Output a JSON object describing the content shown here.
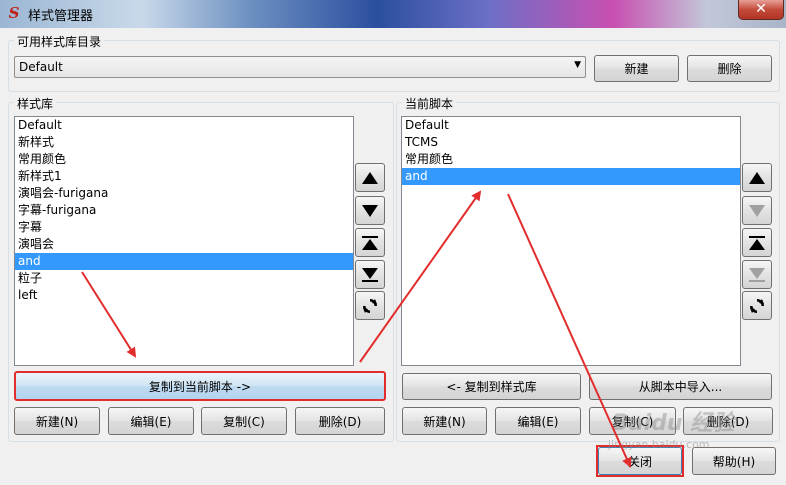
{
  "window": {
    "title": "样式管理器",
    "close_glyph": "✕"
  },
  "library_dir": {
    "label": "可用样式库目录",
    "selected": "Default",
    "new_label": "新建",
    "delete_label": "删除"
  },
  "style_library": {
    "label": "样式库",
    "items": [
      "Default",
      "新样式",
      "常用颜色",
      "新样式1",
      "演唱会-furigana",
      "字幕-furigana",
      "字幕",
      "演唱会",
      "and",
      "粒子",
      "left"
    ],
    "selected_index": 8,
    "copy_to_script_label": "复制到当前脚本 ->",
    "buttons": {
      "new": "新建(N)",
      "edit": "编辑(E)",
      "copy": "复制(C)",
      "delete": "删除(D)"
    }
  },
  "current_script": {
    "label": "当前脚本",
    "items": [
      "Default",
      "TCMS",
      "常用颜色",
      "and"
    ],
    "selected_index": 3,
    "copy_to_library_label": "<- 复制到样式库",
    "import_label": "从脚本中导入...",
    "buttons": {
      "new": "新建(N)",
      "edit": "编辑(E)",
      "copy": "复制(C)",
      "delete": "删除(D)"
    }
  },
  "footer": {
    "close_label": "关闭",
    "help_label": "帮助(H)"
  },
  "watermark": {
    "text": "Baidu 经验",
    "sub": "jingyan.baidu.com"
  },
  "colors": {
    "selection": "#3399ff",
    "annotation": "#e22d2d"
  },
  "icons": {
    "move_up": "triangle-up-icon",
    "move_down": "triangle-down-icon",
    "move_top": "move-to-top-icon",
    "move_bottom": "move-to-bottom-icon",
    "sort": "refresh-icon"
  }
}
